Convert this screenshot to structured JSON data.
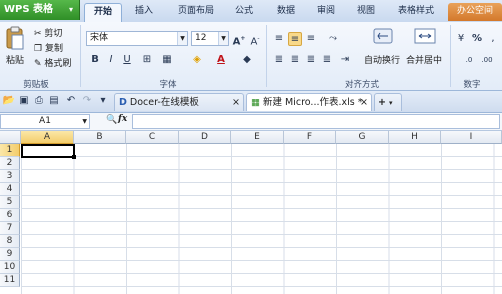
{
  "app": {
    "name": "WPS 表格",
    "menu_arrow": "▾"
  },
  "tabs": [
    "开始",
    "插入",
    "页面布局",
    "公式",
    "数据",
    "审阅",
    "视图",
    "表格样式",
    "办公空间"
  ],
  "ribbon": {
    "clipboard": {
      "paste": "粘贴",
      "cut": "剪切",
      "copy": "复制",
      "format_painter": "格式刷",
      "label": "剪贴板"
    },
    "font": {
      "name": "宋体",
      "size": "12",
      "label": "字体",
      "bold": "B",
      "italic": "I",
      "underline": "U"
    },
    "alignment": {
      "wrap": "自动换行",
      "merge": "合并居中",
      "label": "对齐方式"
    },
    "number": {
      "percent": "%",
      "label": "数字"
    }
  },
  "doc_tabs": [
    {
      "label": "Docer-在线模板",
      "active": false
    },
    {
      "label": "新建 Micro...作表.xls *",
      "active": true
    }
  ],
  "formula_bar": {
    "name_box": "A1",
    "fx": "fx",
    "value": ""
  },
  "columns": [
    "A",
    "B",
    "C",
    "D",
    "E",
    "F",
    "G",
    "H",
    "I"
  ],
  "rows": [
    "1",
    "2",
    "3",
    "4",
    "5",
    "6",
    "7",
    "8",
    "9",
    "10",
    "11"
  ],
  "active_cell": "A1",
  "colors": {
    "app_green": "#3a9a30",
    "office_orange": "#dc8a3d",
    "selection": "#f3cd6c"
  }
}
